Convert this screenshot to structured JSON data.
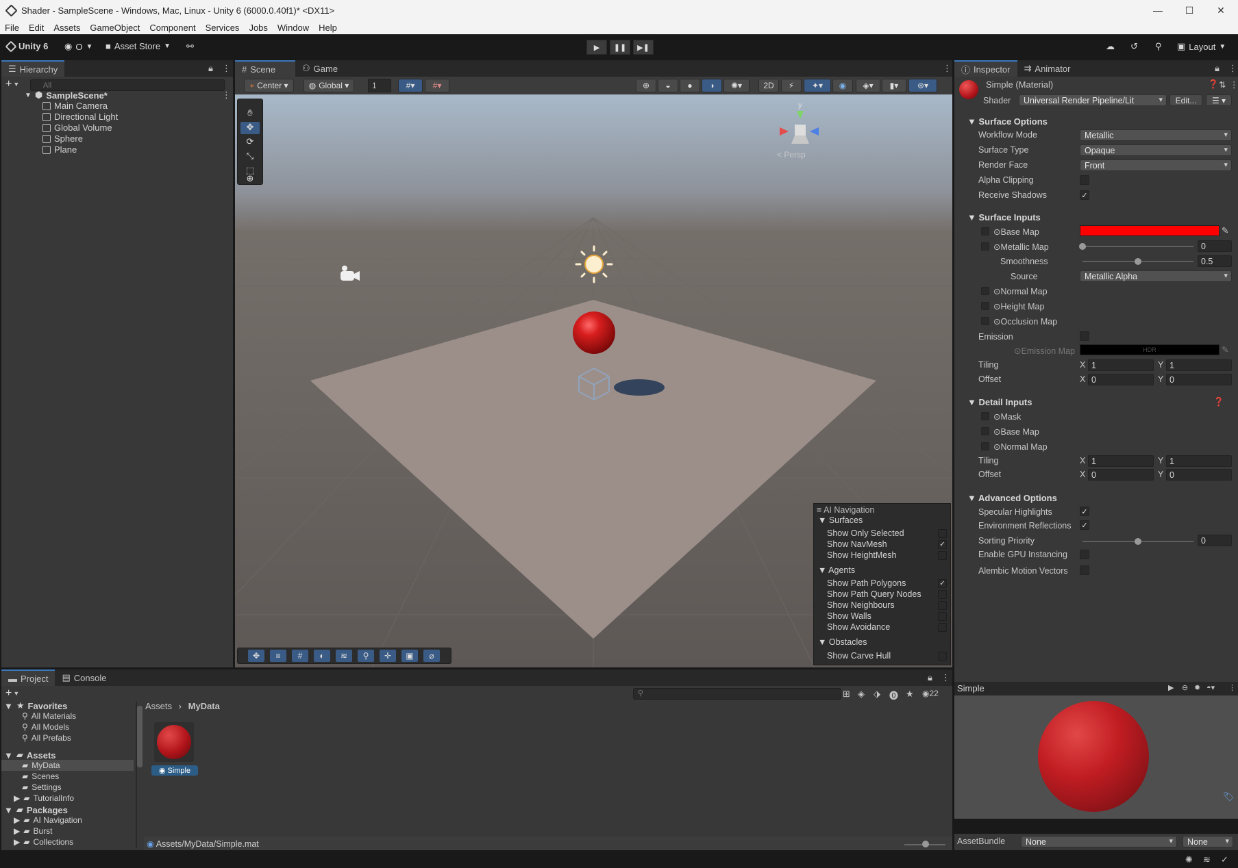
{
  "window": {
    "title": "Shader - SampleScene - Windows, Mac, Linux - Unity 6 (6000.0.40f1)* <DX11>",
    "controls": [
      "—",
      "☐",
      "✕"
    ]
  },
  "menu": [
    "File",
    "Edit",
    "Assets",
    "GameObject",
    "Component",
    "Services",
    "Jobs",
    "Window",
    "Help"
  ],
  "toolbar": {
    "account": "Unity 6",
    "cloud_user": "O",
    "asset_store": "Asset Store",
    "layout": "Layout"
  },
  "hierarchy": {
    "tab": "Hierarchy",
    "search_placeholder": "All",
    "scene": "SampleScene*",
    "items": [
      "Main Camera",
      "Directional Light",
      "Global Volume",
      "Sphere",
      "Plane"
    ]
  },
  "scene_view": {
    "tabs": [
      "Scene",
      "Game"
    ],
    "pivot": "Center",
    "space": "Global",
    "snap_value": "1",
    "persp_label": "< Persp",
    "gizmo_y": "y"
  },
  "ai_navigation": {
    "title": "AI Navigation",
    "sections": [
      {
        "name": "Surfaces",
        "items": [
          {
            "label": "Show Only Selected",
            "checked": false
          },
          {
            "label": "Show NavMesh",
            "checked": true
          },
          {
            "label": "Show HeightMesh",
            "checked": false
          }
        ]
      },
      {
        "name": "Agents",
        "items": [
          {
            "label": "Show Path Polygons",
            "checked": true
          },
          {
            "label": "Show Path Query Nodes",
            "checked": false
          },
          {
            "label": "Show Neighbours",
            "checked": false
          },
          {
            "label": "Show Walls",
            "checked": false
          },
          {
            "label": "Show Avoidance",
            "checked": false
          }
        ]
      },
      {
        "name": "Obstacles",
        "items": [
          {
            "label": "Show Carve Hull",
            "checked": false
          }
        ]
      }
    ]
  },
  "inspector": {
    "tabs": [
      "Inspector",
      "Animator"
    ],
    "material_name": "Simple (Material)",
    "shader_label": "Shader",
    "shader_value": "Universal Render Pipeline/Lit",
    "edit_button": "Edit...",
    "surface_options": {
      "header": "Surface Options",
      "workflow_label": "Workflow Mode",
      "workflow_value": "Metallic",
      "surface_type_label": "Surface Type",
      "surface_type_value": "Opaque",
      "render_face_label": "Render Face",
      "render_face_value": "Front",
      "alpha_clipping_label": "Alpha Clipping",
      "receive_shadows_label": "Receive Shadows"
    },
    "surface_inputs": {
      "header": "Surface Inputs",
      "base_map": "Base Map",
      "base_color": "#ff0000",
      "metallic_map": "Metallic Map",
      "metallic_value": "0",
      "smoothness": "Smoothness",
      "smoothness_value": "0.5",
      "source": "Source",
      "source_value": "Metallic Alpha",
      "normal_map": "Normal Map",
      "height_map": "Height Map",
      "occlusion_map": "Occlusion Map",
      "emission": "Emission",
      "emission_map": "Emission Map",
      "hdr": "HDR",
      "tiling": "Tiling",
      "tiling_x": "1",
      "tiling_y": "1",
      "offset": "Offset",
      "offset_x": "0",
      "offset_y": "0",
      "x": "X",
      "y": "Y"
    },
    "detail_inputs": {
      "header": "Detail Inputs",
      "mask": "Mask",
      "base_map": "Base Map",
      "normal_map": "Normal Map",
      "tiling": "Tiling",
      "tiling_x": "1",
      "tiling_y": "1",
      "offset": "Offset",
      "offset_x": "0",
      "offset_y": "0"
    },
    "advanced_options": {
      "header": "Advanced Options",
      "specular": "Specular Highlights",
      "env_reflections": "Environment Reflections",
      "sorting_priority": "Sorting Priority",
      "sorting_priority_value": "0",
      "gpu_instancing": "Enable GPU Instancing",
      "alembic": "Alembic Motion Vectors"
    },
    "preview_title": "Simple",
    "assetbundle_label": "AssetBundle",
    "assetbundle_value": "None",
    "assetbundle_variant": "None"
  },
  "project": {
    "tabs": [
      "Project",
      "Console"
    ],
    "favorites_header": "Favorites",
    "favorites": [
      "All Materials",
      "All Models",
      "All Prefabs"
    ],
    "assets_header": "Assets",
    "asset_folders": [
      "MyData",
      "Scenes",
      "Settings",
      "TutorialInfo"
    ],
    "packages_header": "Packages",
    "packages": [
      "AI Navigation",
      "Burst",
      "Collections"
    ],
    "breadcrumb": [
      "Assets",
      "MyData"
    ],
    "asset_item": "Simple",
    "hidden_count": "22",
    "status_path": "Assets/MyData/Simple.mat"
  }
}
